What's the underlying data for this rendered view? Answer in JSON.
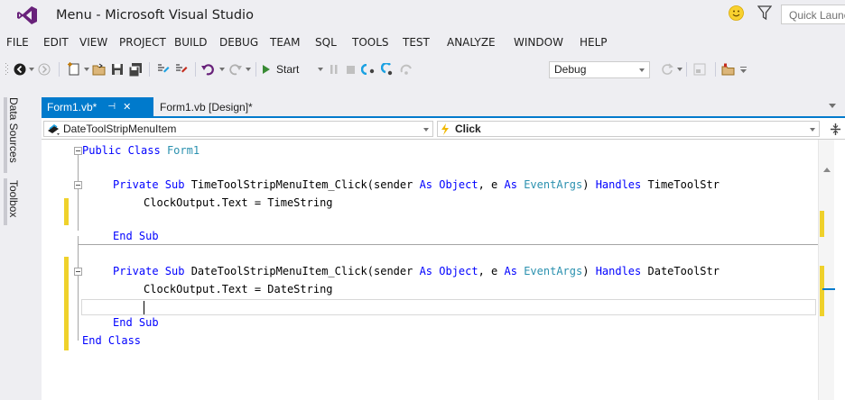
{
  "window": {
    "title": "Menu - Microsoft Visual Studio",
    "quick_launch_placeholder": "Quick Launch"
  },
  "menu": [
    "FILE",
    "EDIT",
    "VIEW",
    "PROJECT",
    "BUILD",
    "DEBUG",
    "TEAM",
    "SQL",
    "TOOLS",
    "TEST",
    "ANALYZE",
    "WINDOW",
    "HELP"
  ],
  "toolbar": {
    "start_label": "Start",
    "configuration": "Debug"
  },
  "side_panels": [
    "Data Sources",
    "Toolbox"
  ],
  "tabs": {
    "active": "Form1.vb*",
    "pin_icon": "⊣",
    "close_icon": "✕",
    "other": "Form1.vb [Design]*"
  },
  "nav": {
    "left": "DateToolStripMenuItem",
    "right": "Click"
  },
  "code": {
    "l1": {
      "kw": "Public Class",
      "name": "Form1"
    },
    "l2": {
      "kw1": "Private Sub",
      "t1": " TimeToolStripMenuItem_Click(sender ",
      "kw2": "As Object",
      "t2": ", e ",
      "kw3": "As",
      "ty": "EventArgs",
      "t3": ") ",
      "kw4": "Handles",
      "t4": " TimeToolStr"
    },
    "l3": "ClockOutput.Text = TimeString",
    "l4": "End Sub",
    "l5": {
      "kw1": "Private Sub",
      "t1": " DateToolStripMenuItem_Click(sender ",
      "kw2": "As Object",
      "t2": ", e ",
      "kw3": "As",
      "ty": "EventArgs",
      "t3": ") ",
      "kw4": "Handles",
      "t4": " DateToolStr"
    },
    "l6": "ClockOutput.Text = DateString",
    "l7": "End Sub",
    "l8": "End Class"
  },
  "colors": {
    "accent": "#007acc",
    "keyword": "#0000ff",
    "type": "#2b91af",
    "change_marker": "#efd12b"
  }
}
